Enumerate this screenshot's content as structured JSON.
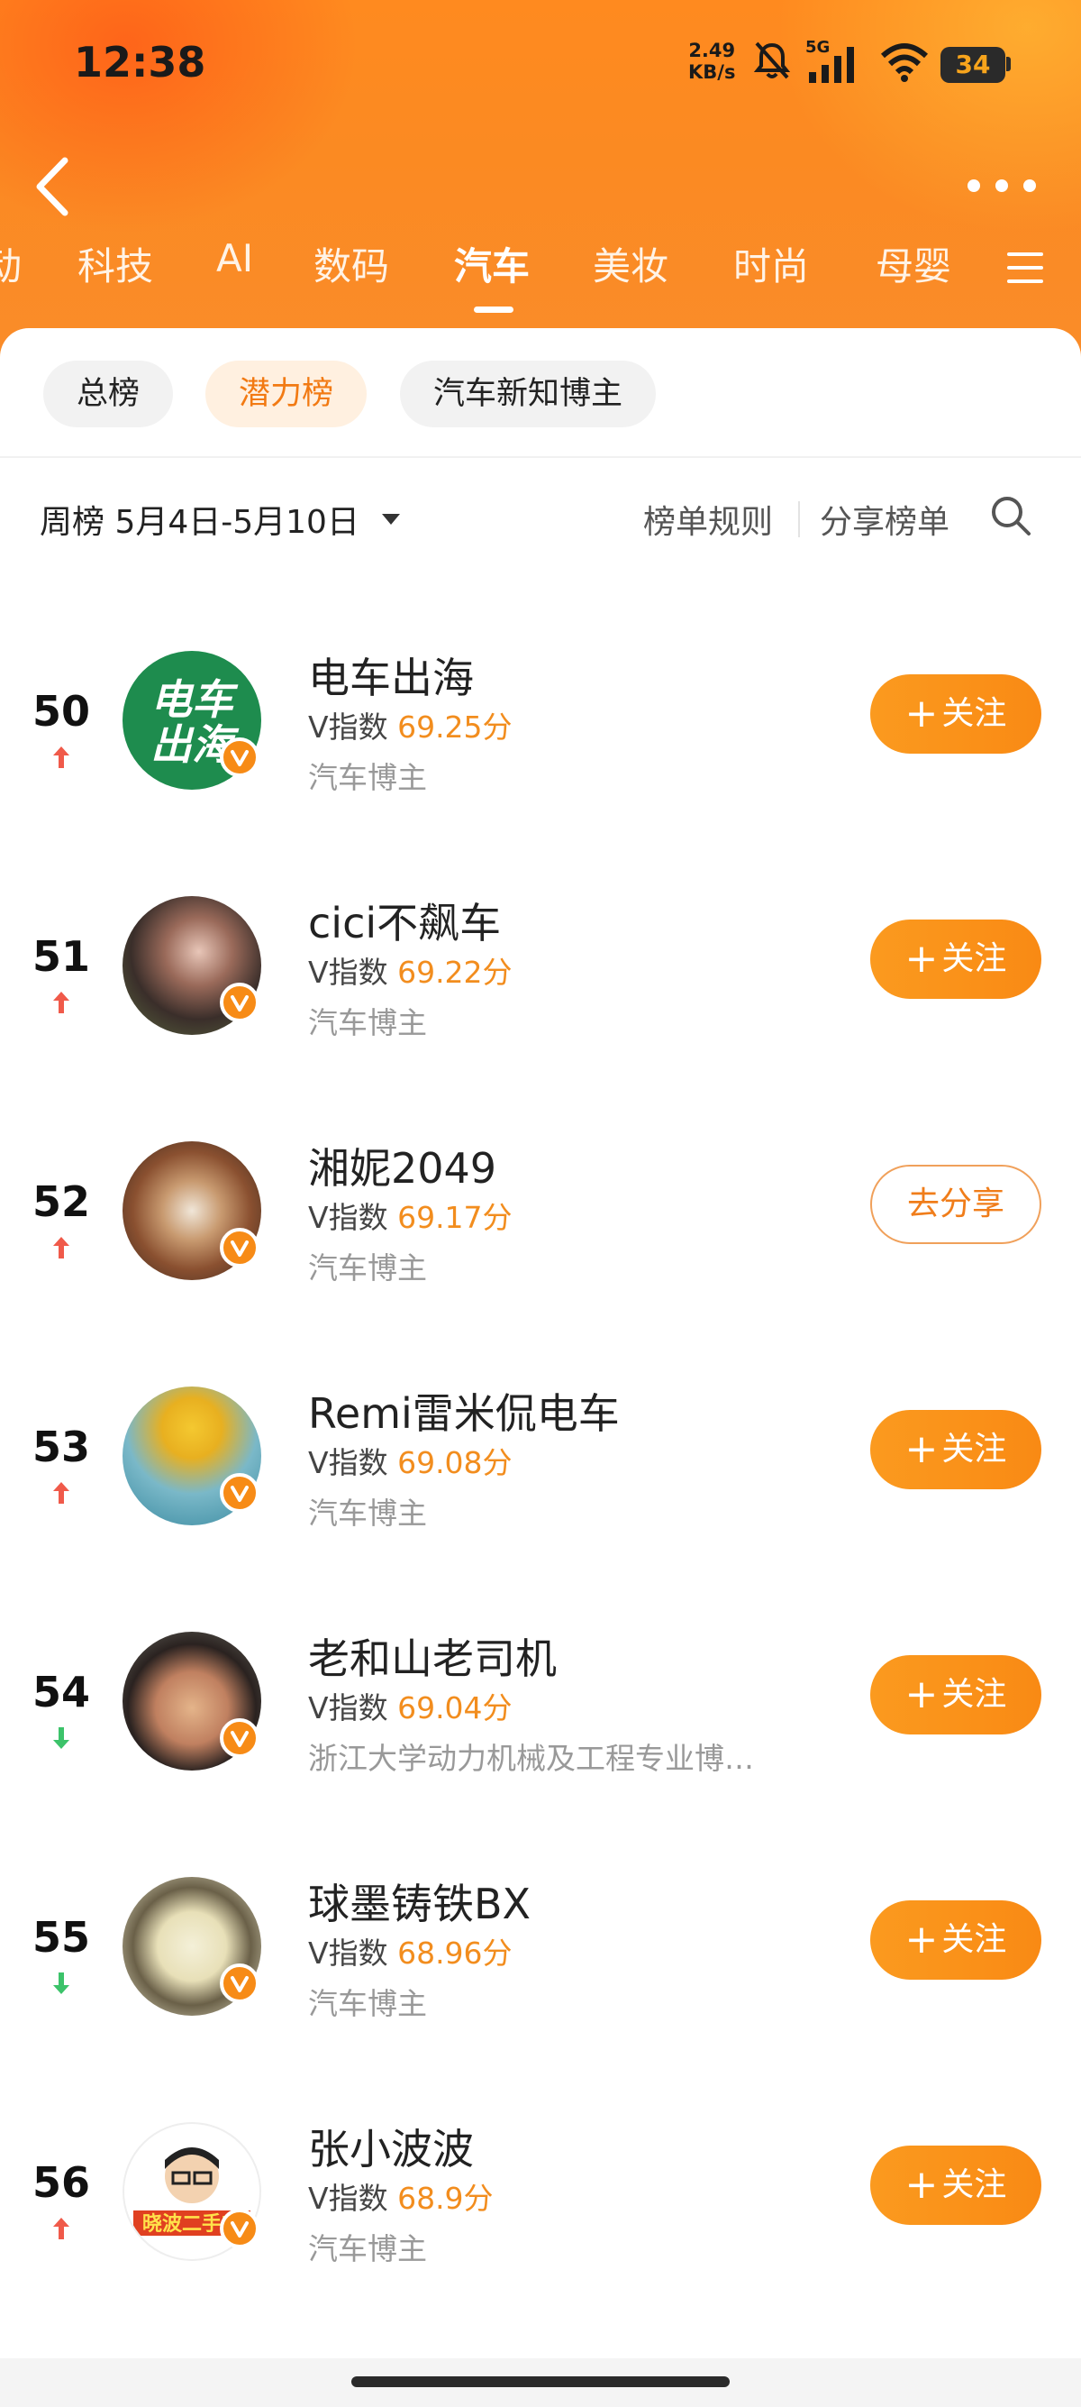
{
  "status_bar": {
    "time": "12:38",
    "speed_value": "2.49",
    "speed_unit": "KB/s",
    "network": "5G",
    "battery": "34"
  },
  "category_tabs": [
    {
      "label": "动"
    },
    {
      "label": "科技"
    },
    {
      "label": "AI"
    },
    {
      "label": "数码"
    },
    {
      "label": "汽车",
      "active": true
    },
    {
      "label": "美妆"
    },
    {
      "label": "时尚"
    },
    {
      "label": "母婴"
    }
  ],
  "sub_tabs": [
    {
      "label": "总榜"
    },
    {
      "label": "潜力榜",
      "active": true
    },
    {
      "label": "汽车新知博主"
    }
  ],
  "toolbar": {
    "week_label": "周榜 5月4日-5月10日",
    "rules_label": "榜单规则",
    "share_label": "分享榜单"
  },
  "list": [
    {
      "rank": "50",
      "trend": "up",
      "name": "电车出海",
      "vindex_label": "V指数",
      "score": "69.25分",
      "tag": "汽车博主",
      "button": "关注",
      "button_type": "follow"
    },
    {
      "rank": "51",
      "trend": "up",
      "name": "cici不飙车",
      "vindex_label": "V指数",
      "score": "69.22分",
      "tag": "汽车博主",
      "button": "关注",
      "button_type": "follow"
    },
    {
      "rank": "52",
      "trend": "up",
      "name": "湘妮2049",
      "vindex_label": "V指数",
      "score": "69.17分",
      "tag": "汽车博主",
      "button": "去分享",
      "button_type": "share"
    },
    {
      "rank": "53",
      "trend": "up",
      "name": "Remi雷米侃电车",
      "vindex_label": "V指数",
      "score": "69.08分",
      "tag": "汽车博主",
      "button": "关注",
      "button_type": "follow"
    },
    {
      "rank": "54",
      "trend": "down",
      "name": "老和山老司机",
      "vindex_label": "V指数",
      "score": "69.04分",
      "tag": "浙江大学动力机械及工程专业博…",
      "button": "关注",
      "button_type": "follow"
    },
    {
      "rank": "55",
      "trend": "down",
      "name": "球墨铸铁BX",
      "vindex_label": "V指数",
      "score": "68.96分",
      "tag": "汽车博主",
      "button": "关注",
      "button_type": "follow"
    },
    {
      "rank": "56",
      "trend": "up",
      "name": "张小波波",
      "vindex_label": "V指数",
      "score": "68.9分",
      "tag": "汽车博主",
      "button": "关注",
      "button_type": "follow"
    }
  ],
  "avatar_texts": {
    "row0": [
      "电车",
      "出海"
    ],
    "row6": "晓波二手车"
  },
  "colors": {
    "accent": "#f98a14",
    "up": "#f05a4a",
    "down": "#3cc36a",
    "score": "#f28d1e"
  }
}
